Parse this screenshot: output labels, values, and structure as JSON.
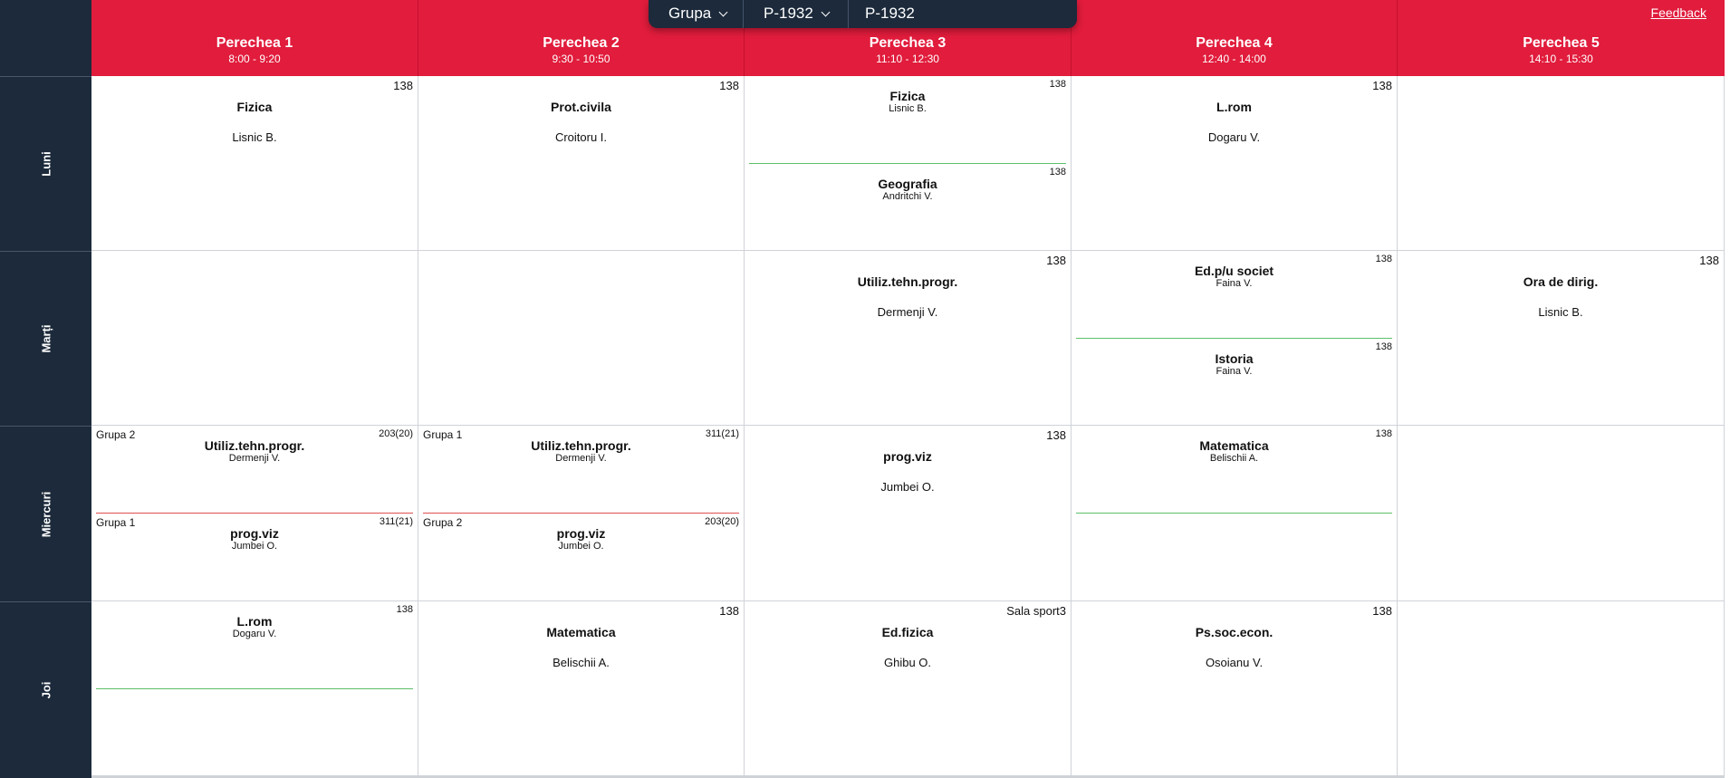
{
  "topbar": {
    "type_label": "Grupa",
    "group_label": "P-1932",
    "current_label": "P-1932"
  },
  "feedback": "Feedback",
  "periods": [
    {
      "name": "Perechea 1",
      "time": "8:00 - 9:20"
    },
    {
      "name": "Perechea 2",
      "time": "9:30 - 10:50"
    },
    {
      "name": "Perechea 3",
      "time": "11:10 - 12:30"
    },
    {
      "name": "Perechea 4",
      "time": "12:40 - 14:00"
    },
    {
      "name": "Perechea 5",
      "time": "14:10 - 15:30"
    }
  ],
  "days": [
    "Luni",
    "Marți",
    "Miercuri",
    "Joi"
  ],
  "schedule": {
    "luni": {
      "p1": {
        "room": "138",
        "subject": "Fizica",
        "teacher": "Lisnic B."
      },
      "p2": {
        "room": "138",
        "subject": "Prot.civila",
        "teacher": "Croitoru I."
      },
      "p3": {
        "top": {
          "room": "138",
          "subject": "Fizica",
          "teacher": "Lisnic B."
        },
        "bottom": {
          "room": "138",
          "subject": "Geografia",
          "teacher": "Andritchi V."
        }
      },
      "p4": {
        "room": "138",
        "subject": "L.rom",
        "teacher": "Dogaru V."
      }
    },
    "marti": {
      "p3": {
        "room": "138",
        "subject": "Utiliz.tehn.progr.",
        "teacher": "Dermenji V."
      },
      "p4": {
        "top": {
          "room": "138",
          "subject": "Ed.p/u societ",
          "teacher": "Faina V."
        },
        "bottom": {
          "room": "138",
          "subject": "Istoria",
          "teacher": "Faina V."
        }
      },
      "p5": {
        "room": "138",
        "subject": "Ora de dirig.",
        "teacher": "Lisnic B."
      }
    },
    "miercuri": {
      "p1": {
        "top": {
          "group": "Grupa 2",
          "room": "203(20)",
          "subject": "Utiliz.tehn.progr.",
          "teacher": "Dermenji V."
        },
        "bottom": {
          "group": "Grupa 1",
          "room": "311(21)",
          "subject": "prog.viz",
          "teacher": "Jumbei O."
        }
      },
      "p2": {
        "top": {
          "group": "Grupa 1",
          "room": "311(21)",
          "subject": "Utiliz.tehn.progr.",
          "teacher": "Dermenji V."
        },
        "bottom": {
          "group": "Grupa 2",
          "room": "203(20)",
          "subject": "prog.viz",
          "teacher": "Jumbei O."
        }
      },
      "p3": {
        "room": "138",
        "subject": "prog.viz",
        "teacher": "Jumbei O."
      },
      "p4": {
        "top": {
          "room": "138",
          "subject": "Matematica",
          "teacher": "Belischii A."
        }
      }
    },
    "joi": {
      "p1": {
        "top": {
          "room": "138",
          "subject": "L.rom",
          "teacher": "Dogaru V."
        }
      },
      "p2": {
        "room": "138",
        "subject": "Matematica",
        "teacher": "Belischii A."
      },
      "p3": {
        "room": "Sala sport3",
        "subject": "Ed.fizica",
        "teacher": "Ghibu O."
      },
      "p4": {
        "room": "138",
        "subject": "Ps.soc.econ.",
        "teacher": "Osoianu V."
      }
    }
  }
}
